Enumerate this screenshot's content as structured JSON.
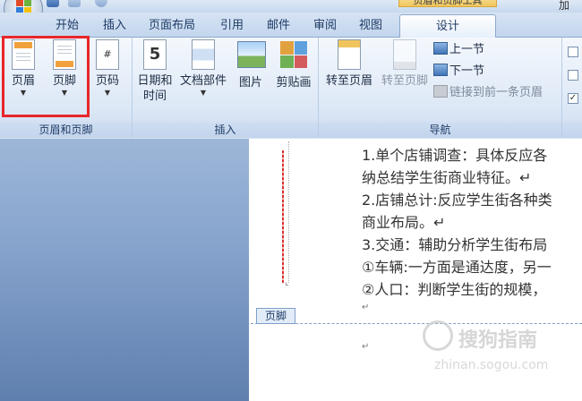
{
  "titlebar": {
    "context_tab_title": "页眉和页脚工具",
    "right_text": "加"
  },
  "tabs": [
    {
      "label": "开始"
    },
    {
      "label": "插入"
    },
    {
      "label": "页面布局"
    },
    {
      "label": "引用"
    },
    {
      "label": "邮件"
    },
    {
      "label": "审阅"
    },
    {
      "label": "视图"
    },
    {
      "label": "设计"
    }
  ],
  "ribbon": {
    "header_footer_group": {
      "label": "页眉和页脚",
      "header_button": "页眉",
      "footer_button": "页脚",
      "page_number_button": "页码"
    },
    "insert_group": {
      "label": "插入",
      "datetime_button_line1": "日期和",
      "datetime_button_line2": "时间",
      "docparts_button": "文档部件",
      "picture_button": "图片",
      "clipart_button": "剪贴画"
    },
    "navigation_group": {
      "label": "导航",
      "goto_header": "转至页眉",
      "goto_footer": "转至页脚",
      "prev_section": "上一节",
      "next_section": "下一节",
      "link_previous": "链接到前一条页眉"
    },
    "options_group": {
      "checkbox_states": [
        false,
        false,
        true
      ]
    }
  },
  "document": {
    "lines": [
      "1.单个店铺调查：具体反应各",
      "纳总结学生街商业特征。↵",
      "2.店铺总计:反应学生街各种类",
      "商业布局。↵",
      "3.交通：辅助分析学生街布局",
      "①车辆:一方面是通达度，另一",
      "②人口：判断学生街的规模，"
    ],
    "footer_tag": "页脚",
    "para_mark": "↵"
  },
  "watermark": {
    "text": "搜狗指南",
    "url": "zhinan.sogou.com"
  },
  "colors": {
    "highlight_box": "#e8262a",
    "ribbon_bg": "#dde8f6",
    "doc_bg": "#87a4cd"
  }
}
